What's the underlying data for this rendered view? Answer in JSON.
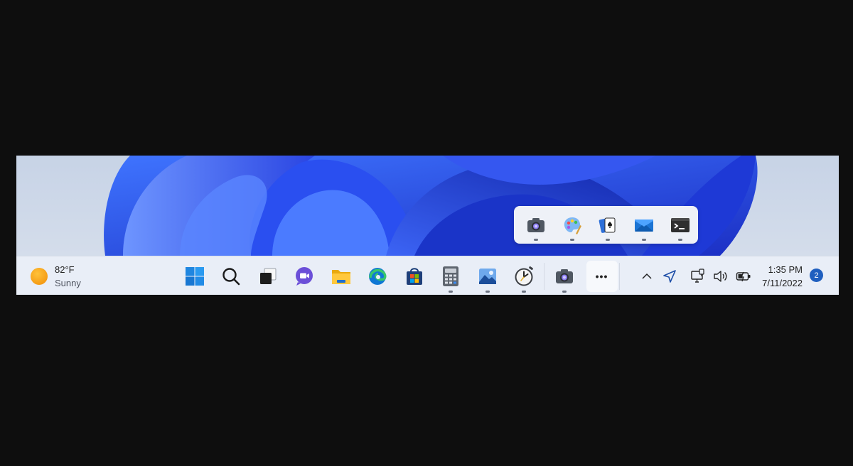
{
  "weather": {
    "temperature": "82°F",
    "condition": "Sunny",
    "icon": "sun-icon"
  },
  "taskbar": {
    "apps": [
      {
        "name": "start",
        "icon": "windows-logo-icon",
        "running": false
      },
      {
        "name": "search",
        "icon": "search-icon",
        "running": false
      },
      {
        "name": "task-view",
        "icon": "task-view-icon",
        "running": false
      },
      {
        "name": "teams-chat",
        "icon": "video-chat-icon",
        "running": false
      },
      {
        "name": "file-explorer",
        "icon": "folder-icon",
        "running": false
      },
      {
        "name": "edge",
        "icon": "edge-browser-icon",
        "running": false
      },
      {
        "name": "store",
        "icon": "store-icon",
        "running": false
      },
      {
        "name": "calculator",
        "icon": "calculator-icon",
        "running": true
      },
      {
        "name": "photos",
        "icon": "photos-icon",
        "running": true
      },
      {
        "name": "alarms-clock",
        "icon": "clock-icon",
        "running": true
      },
      {
        "name": "camera",
        "icon": "camera-icon",
        "running": true
      }
    ],
    "more_label": "•••"
  },
  "overflow_menu": {
    "items": [
      {
        "name": "camera",
        "icon": "camera-icon"
      },
      {
        "name": "paint",
        "icon": "paint-palette-icon"
      },
      {
        "name": "solitaire",
        "icon": "cards-icon"
      },
      {
        "name": "mail",
        "icon": "mail-icon"
      },
      {
        "name": "terminal",
        "icon": "terminal-icon"
      }
    ]
  },
  "tray": {
    "icons": [
      "chevron-up-icon",
      "location-icon",
      "network-icon",
      "volume-icon",
      "battery-icon"
    ]
  },
  "clock": {
    "time": "1:35 PM",
    "date": "7/11/2022"
  },
  "notifications": {
    "count": "2"
  },
  "colors": {
    "accent": "#1f5fbf",
    "taskbar_bg": "#e9eef7",
    "wallpaper_blue": "#2f4fe0"
  }
}
